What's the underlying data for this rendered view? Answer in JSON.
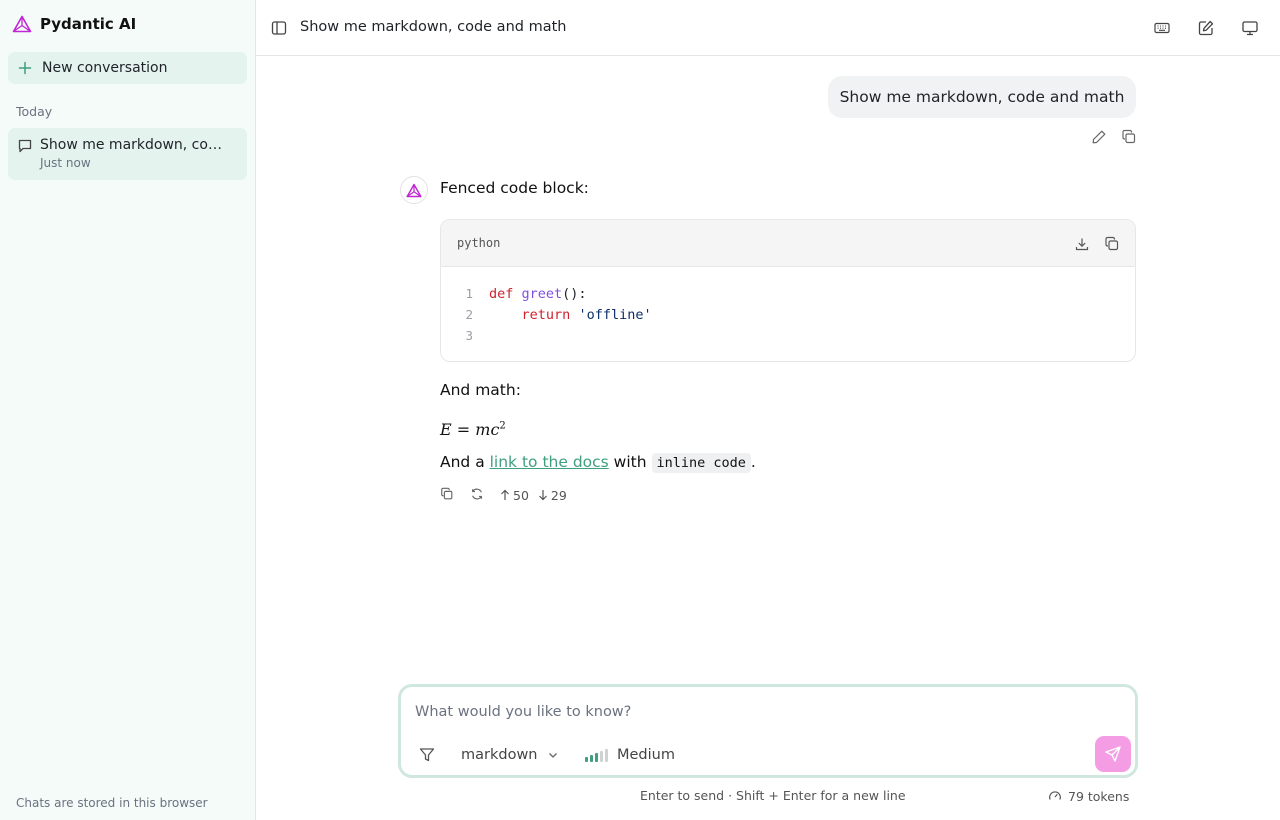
{
  "app": {
    "name": "Pydantic AI",
    "accent_color": "#e04bd0",
    "brand_color": "#c026d3"
  },
  "sidebar": {
    "new_conversation_label": "New conversation",
    "section_label": "Today",
    "conversations": [
      {
        "title": "Show me markdown, code and math",
        "time": "Just now",
        "icon": "chat-bubble-icon"
      }
    ],
    "footer": "Chats are stored in this browser"
  },
  "header": {
    "title": "Show me markdown, code and math",
    "icons": [
      "sidebar-toggle-icon",
      "keyboard-icon",
      "compose-icon",
      "monitor-icon"
    ]
  },
  "messages": {
    "user": {
      "text": "Show me markdown, code and math",
      "actions": [
        "edit-icon",
        "copy-icon"
      ]
    },
    "assistant": {
      "intro": "Fenced code block:",
      "code": {
        "language": "python",
        "lines": [
          {
            "n": "1",
            "tokens": [
              {
                "t": "def",
                "c": "kw"
              },
              {
                "t": " "
              },
              {
                "t": "greet",
                "c": "fn"
              },
              {
                "t": "():",
                "c": "pun"
              }
            ]
          },
          {
            "n": "2",
            "tokens": [
              {
                "t": "    "
              },
              {
                "t": "return",
                "c": "kw"
              },
              {
                "t": " "
              },
              {
                "t": "'offline'",
                "c": "str"
              }
            ]
          },
          {
            "n": "3",
            "tokens": []
          }
        ]
      },
      "math_intro": "And math:",
      "math": {
        "lhs": "E",
        "eq": " = ",
        "rhs": "mc",
        "exp": "2"
      },
      "para": {
        "before": "And a ",
        "link": "link to the docs",
        "middle": " with ",
        "code": "inline code",
        "after": "."
      },
      "feedback": {
        "up_count": "50",
        "down_count": "29"
      }
    }
  },
  "composer": {
    "placeholder": "What would you like to know?",
    "value": "",
    "model": "markdown",
    "effort": "Medium",
    "effort_level": 3,
    "effort_max": 5,
    "hint": "Enter to send · Shift + Enter for a new line",
    "tokens": "79 tokens",
    "send_color": "#f49ce4"
  }
}
